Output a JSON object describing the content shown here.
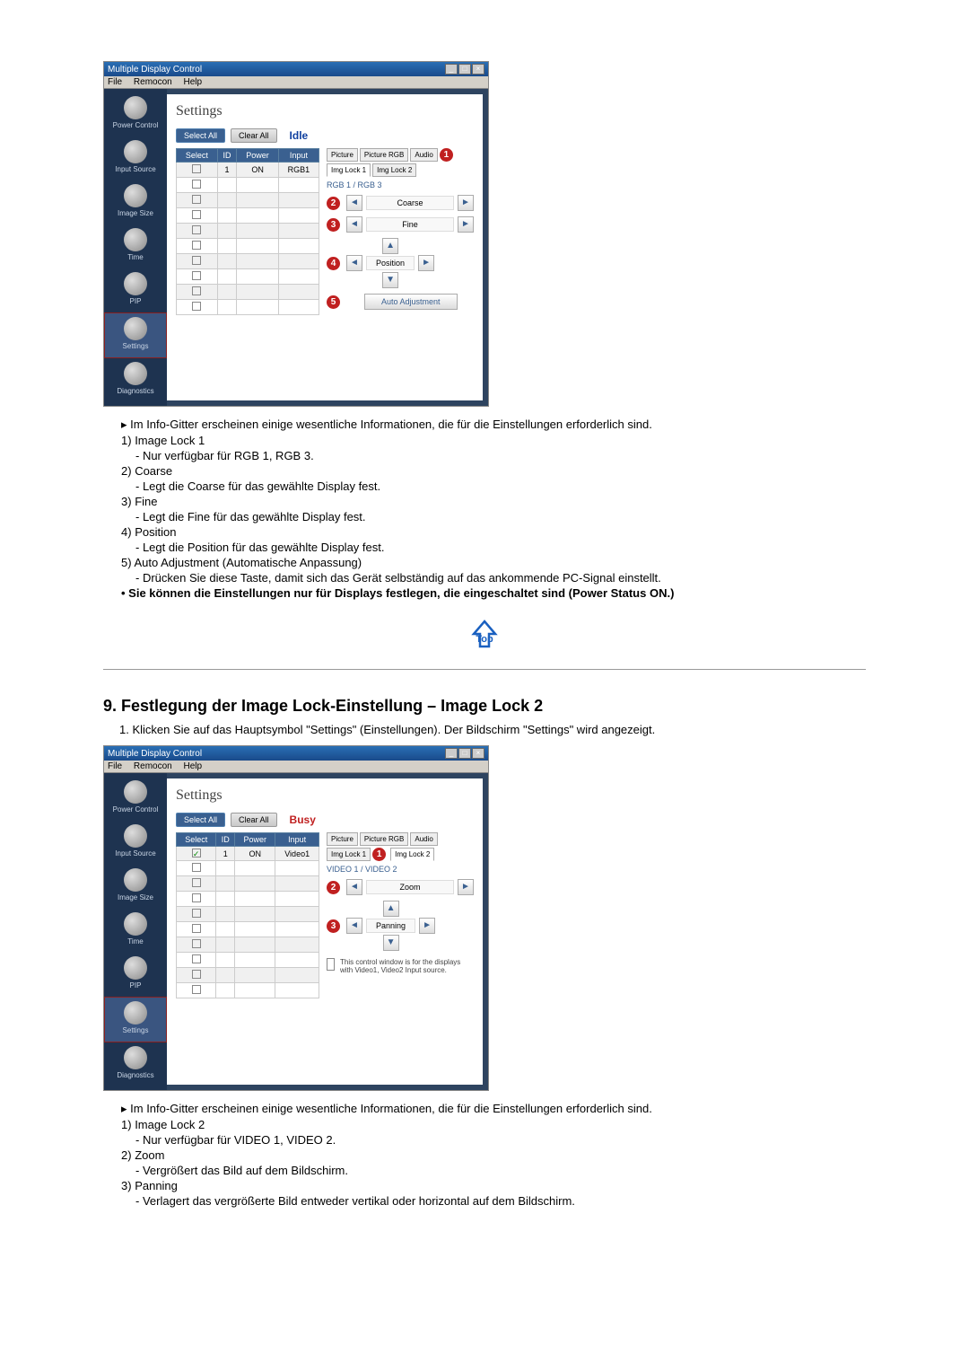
{
  "screenshot1": {
    "app_title": "Multiple Display Control",
    "menus": [
      "File",
      "Remocon",
      "Help"
    ],
    "sidebar": [
      {
        "label": "Power Control"
      },
      {
        "label": "Input Source"
      },
      {
        "label": "Image Size"
      },
      {
        "label": "Time"
      },
      {
        "label": "PIP"
      },
      {
        "label": "Settings",
        "selected": true
      },
      {
        "label": "Diagnostics"
      }
    ],
    "pane_title": "Settings",
    "select_all": "Select All",
    "clear_all": "Clear All",
    "status": "Idle",
    "grid_headers": [
      "Select",
      "ID",
      "Power",
      "Input"
    ],
    "grid_rows": [
      {
        "sel": false,
        "id": "1",
        "power": "ON",
        "input": "RGB1"
      },
      {
        "sel": false
      },
      {
        "sel": false
      },
      {
        "sel": false
      },
      {
        "sel": false
      },
      {
        "sel": false
      },
      {
        "sel": false
      },
      {
        "sel": false
      },
      {
        "sel": false
      },
      {
        "sel": false
      }
    ],
    "tabs": [
      "Picture",
      "Picture RGB",
      "Audio",
      "Img Lock 1",
      "Img Lock 2"
    ],
    "tabs_active": 3,
    "sub_label": "RGB 1 / RGB 3",
    "controls": {
      "coarse": "Coarse",
      "fine": "Fine",
      "position": "Position",
      "auto": "Auto Adjustment"
    }
  },
  "doc1": {
    "info_line": "Im Info-Gitter erscheinen einige wesentliche Informationen, die für die Einstellungen erforderlich sind.",
    "items": [
      {
        "num": "1)",
        "title": "Image Lock 1",
        "desc": "- Nur verfügbar für RGB 1, RGB 3."
      },
      {
        "num": "2)",
        "title": "Coarse",
        "desc": "- Legt die Coarse für das gewählte Display fest."
      },
      {
        "num": "3)",
        "title": "Fine",
        "desc": "- Legt die Fine für das gewählte Display fest."
      },
      {
        "num": "4)",
        "title": "Position",
        "desc": "- Legt die Position für das gewählte Display fest."
      },
      {
        "num": "5)",
        "title": "Auto Adjustment (Automatische Anpassung)",
        "desc": "- Drücken Sie diese Taste, damit sich das Gerät selbständig auf das ankommende PC-Signal einstellt."
      }
    ],
    "note": "Sie können die Einstellungen nur für Displays festlegen, die eingeschaltet sind (Power Status ON.)"
  },
  "section2": {
    "heading": "9. Festlegung der Image Lock-Einstellung – Image Lock 2",
    "step1": "1. Klicken Sie auf das Hauptsymbol \"Settings\" (Einstellungen). Der Bildschirm \"Settings\" wird angezeigt."
  },
  "screenshot2": {
    "app_title": "Multiple Display Control",
    "menus": [
      "File",
      "Remocon",
      "Help"
    ],
    "pane_title": "Settings",
    "select_all": "Select All",
    "clear_all": "Clear All",
    "status": "Busy",
    "grid_headers": [
      "Select",
      "ID",
      "Power",
      "Input"
    ],
    "grid_rows": [
      {
        "sel": true,
        "id": "1",
        "power": "ON",
        "input": "Video1"
      },
      {
        "sel": false
      },
      {
        "sel": false
      },
      {
        "sel": false
      },
      {
        "sel": false
      },
      {
        "sel": false
      },
      {
        "sel": false
      },
      {
        "sel": false
      },
      {
        "sel": false
      },
      {
        "sel": false
      }
    ],
    "tabs": [
      "Picture",
      "Picture RGB",
      "Audio",
      "Img Lock 1",
      "Img Lock 2"
    ],
    "tabs_active": 4,
    "sub_label": "VIDEO 1 / VIDEO 2",
    "controls": {
      "zoom": "Zoom",
      "panning": "Panning"
    },
    "info_note": "This control window is for the displays with Video1, Video2 Input source."
  },
  "doc2": {
    "info_line": "Im Info-Gitter erscheinen einige wesentliche Informationen, die für die Einstellungen erforderlich sind.",
    "items": [
      {
        "num": "1)",
        "title": "Image Lock 2",
        "desc": "- Nur verfügbar für VIDEO 1, VIDEO 2."
      },
      {
        "num": "2)",
        "title": "Zoom",
        "desc": "- Vergrößert das Bild auf dem Bildschirm."
      },
      {
        "num": "3)",
        "title": "Panning",
        "desc": "- Verlagert das vergrößerte Bild entweder vertikal oder horizontal auf dem Bildschirm."
      }
    ]
  },
  "top_label": "Top"
}
